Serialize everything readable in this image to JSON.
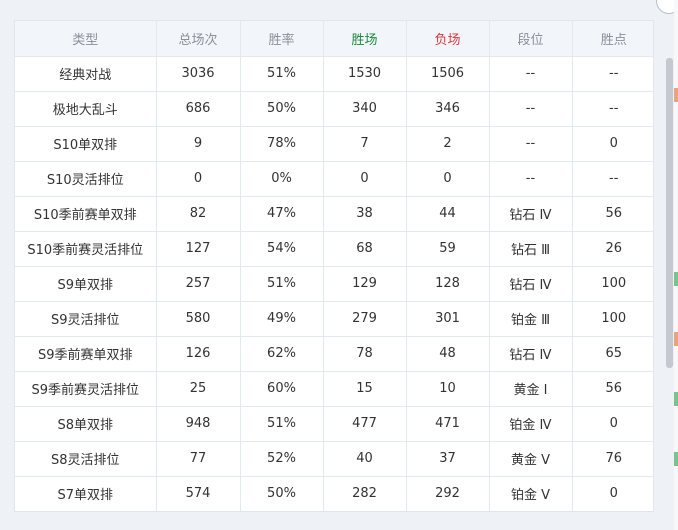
{
  "table": {
    "headers": [
      "类型",
      "总场次",
      "胜率",
      "胜场",
      "负场",
      "段位",
      "胜点"
    ],
    "rows": [
      [
        "经典对战",
        "3036",
        "51%",
        "1530",
        "1506",
        "--",
        "--"
      ],
      [
        "极地大乱斗",
        "686",
        "50%",
        "340",
        "346",
        "--",
        "--"
      ],
      [
        "S10单双排",
        "9",
        "78%",
        "7",
        "2",
        "--",
        "0"
      ],
      [
        "S10灵活排位",
        "0",
        "0%",
        "0",
        "0",
        "--",
        "--"
      ],
      [
        "S10季前赛单双排",
        "82",
        "47%",
        "38",
        "44",
        "钻石 Ⅳ",
        "56"
      ],
      [
        "S10季前赛灵活排位",
        "127",
        "54%",
        "68",
        "59",
        "钻石 Ⅲ",
        "26"
      ],
      [
        "S9单双排",
        "257",
        "51%",
        "129",
        "128",
        "钻石 Ⅳ",
        "100"
      ],
      [
        "S9灵活排位",
        "580",
        "49%",
        "279",
        "301",
        "铂金 Ⅲ",
        "100"
      ],
      [
        "S9季前赛单双排",
        "126",
        "62%",
        "78",
        "48",
        "钻石 Ⅳ",
        "65"
      ],
      [
        "S9季前赛灵活排位",
        "25",
        "60%",
        "15",
        "10",
        "黄金 Ⅰ",
        "56"
      ],
      [
        "S8单双排",
        "948",
        "51%",
        "477",
        "471",
        "铂金 Ⅳ",
        "0"
      ],
      [
        "S8灵活排位",
        "77",
        "52%",
        "40",
        "37",
        "黄金 Ⅴ",
        "76"
      ],
      [
        "S7单双排",
        "574",
        "50%",
        "282",
        "292",
        "铂金 Ⅴ",
        "0"
      ]
    ]
  },
  "colors": {
    "win_header": "#1a8a3a",
    "loss_header": "#d9363e",
    "header_text": "#8a8f99",
    "cell_text": "#333333"
  },
  "icons": {
    "corner": "close-circle-icon"
  }
}
